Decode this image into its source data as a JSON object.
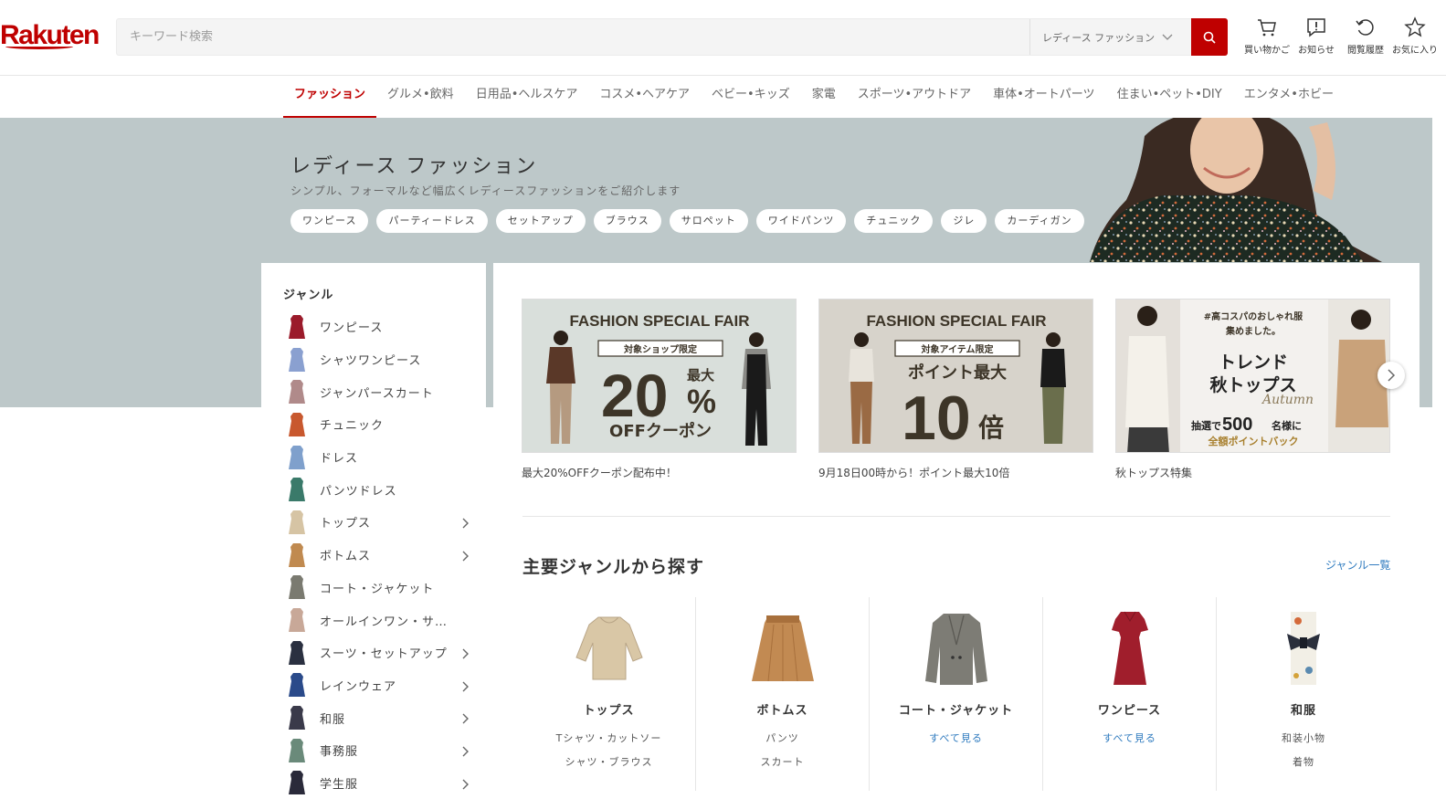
{
  "header": {
    "logo": "Rakuten",
    "search_placeholder": "キーワード検索",
    "search_category": "レディース ファッション",
    "icons": [
      {
        "label": "買い物かご",
        "icon": "cart-icon"
      },
      {
        "label": "お知らせ",
        "icon": "notification-icon"
      },
      {
        "label": "閲覧履歴",
        "icon": "history-icon"
      },
      {
        "label": "お気に入り",
        "icon": "star-icon"
      }
    ]
  },
  "nav": {
    "items": [
      {
        "label": "ファッション",
        "active": true
      },
      {
        "label": "グルメ•飲料"
      },
      {
        "label": "日用品•ヘルスケア"
      },
      {
        "label": "コスメ•ヘアケア"
      },
      {
        "label": "ベビー•キッズ"
      },
      {
        "label": "家電"
      },
      {
        "label": "スポーツ•アウトドア"
      },
      {
        "label": "車体•オートパーツ"
      },
      {
        "label": "住まい•ペット•DIY"
      },
      {
        "label": "エンタメ•ホビー"
      }
    ]
  },
  "hero": {
    "title": "レディース ファッション",
    "subtitle": "シンプル、フォーマルなど幅広くレディースファッションをご紹介します",
    "chips": [
      "ワンピース",
      "パーティードレス",
      "セットアップ",
      "ブラウス",
      "サロペット",
      "ワイドパンツ",
      "チュニック",
      "ジレ",
      "カーディガン"
    ]
  },
  "sidebar": {
    "title": "ジャンル",
    "items": [
      {
        "label": "ワンピース",
        "color": "#9b1b2b",
        "has_children": false
      },
      {
        "label": "シャツワンピース",
        "color": "#8aa0d0",
        "has_children": false
      },
      {
        "label": "ジャンパースカート",
        "color": "#b08a8a",
        "has_children": false
      },
      {
        "label": "チュニック",
        "color": "#c8582e",
        "has_children": false
      },
      {
        "label": "ドレス",
        "color": "#7fa0cc",
        "has_children": false
      },
      {
        "label": "パンツドレス",
        "color": "#3a7a6a",
        "has_children": false
      },
      {
        "label": "トップス",
        "color": "#d6c4a4",
        "has_children": true
      },
      {
        "label": "ボトムス",
        "color": "#c08a50",
        "has_children": true
      },
      {
        "label": "コート・ジャケット",
        "color": "#7a7a70",
        "has_children": false
      },
      {
        "label": "オールインワン・サ…",
        "color": "#c8a898",
        "has_children": false
      },
      {
        "label": "スーツ・セットアップ",
        "color": "#2a3040",
        "has_children": true
      },
      {
        "label": "レインウェア",
        "color": "#2a4a8a",
        "has_children": true
      },
      {
        "label": "和服",
        "color": "#3a3a4a",
        "has_children": true
      },
      {
        "label": "事務服",
        "color": "#6a8a7a",
        "has_children": true
      },
      {
        "label": "学生服",
        "color": "#2a2a3a",
        "has_children": true
      }
    ]
  },
  "banners": [
    {
      "heading": "FASHION SPECIAL FAIR",
      "tag": "対象ショップ限定",
      "big": "20",
      "unit": "%",
      "side": "最大",
      "foot": "OFFクーポン",
      "caption": "最大20%OFFクーポン配布中！"
    },
    {
      "heading": "FASHION SPECIAL FAIR",
      "tag": "対象アイテム限定",
      "line": "ポイント最大",
      "big": "10",
      "unit": "倍",
      "caption": "9月18日00時から！ポイント最大10倍"
    },
    {
      "top": "#高コスパのおしゃれ服",
      "top2": "集めました。",
      "title1": "トレンド",
      "title2": "秋トップス",
      "script": "Autumn",
      "lottery_pre": "抽選で",
      "lottery_num": "500",
      "lottery_post": "名様に",
      "back": "全額ポイントバック",
      "caption": "秋トップス特集"
    }
  ],
  "genre_section": {
    "title": "主要ジャンルから探す",
    "link": "ジャンル一覧",
    "categories": [
      {
        "name": "トップス",
        "subs": [
          "Tシャツ・カットソー",
          "シャツ・ブラウス"
        ],
        "color": "#d9c7a6"
      },
      {
        "name": "ボトムス",
        "subs": [
          "パンツ",
          "スカート"
        ],
        "color": "#c28a52"
      },
      {
        "name": "コート・ジャケット",
        "more": "すべて見る",
        "color": "#7d7c75"
      },
      {
        "name": "ワンピース",
        "more": "すべて見る",
        "color": "#a01e2c"
      },
      {
        "name": "和服",
        "subs": [
          "和装小物",
          "着物"
        ],
        "color": "#2a2f3c"
      }
    ]
  }
}
